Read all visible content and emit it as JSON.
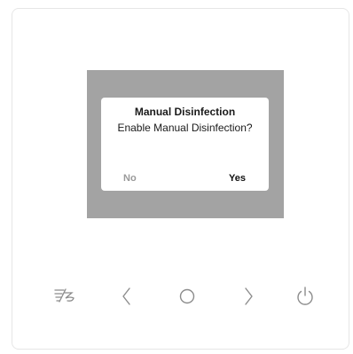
{
  "dialog": {
    "title": "Manual Disinfection",
    "message": "Enable Manual Disinfection?",
    "no_label": "No",
    "yes_label": "Yes"
  },
  "keys": {
    "fan": "fan-speed-icon",
    "left": "chevron-left-icon",
    "ok": "circle-icon",
    "right": "chevron-right-icon",
    "power": "power-icon"
  },
  "colors": {
    "screen_bg": "#a3a3a3",
    "dialog_bg": "#ffffff",
    "no_text": "#9a9a9a",
    "yes_text": "#111111",
    "key_stroke": "#8c8c8c"
  }
}
